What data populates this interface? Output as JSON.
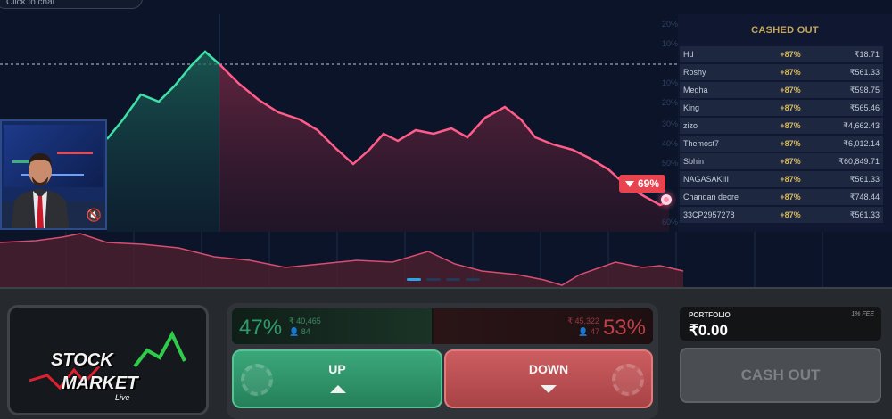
{
  "chat": {
    "placeholder": "Click to chat"
  },
  "chart": {
    "ylabels": [
      "20%",
      "10%",
      "10%",
      "20%",
      "30%",
      "40%",
      "50%",
      "60%"
    ],
    "current_label": "69%",
    "colors": {
      "up": "#3fe0a8",
      "down": "#ff5c8a"
    }
  },
  "leaderboard": {
    "title": "CASHED OUT",
    "rows": [
      {
        "name": "Hd",
        "pct": "+87%",
        "amount": "₹18.71"
      },
      {
        "name": "Roshy",
        "pct": "+87%",
        "amount": "₹561.33"
      },
      {
        "name": "Megha",
        "pct": "+87%",
        "amount": "₹598.75"
      },
      {
        "name": "King",
        "pct": "+87%",
        "amount": "₹565.46"
      },
      {
        "name": "zizo",
        "pct": "+87%",
        "amount": "₹4,662.43"
      },
      {
        "name": "Themost7",
        "pct": "+87%",
        "amount": "₹6,012.14"
      },
      {
        "name": "Sbhin",
        "pct": "+87%",
        "amount": "₹60,849.71"
      },
      {
        "name": "NAGASAKIII",
        "pct": "+87%",
        "amount": "₹561.33"
      },
      {
        "name": "Chandan deore",
        "pct": "+87%",
        "amount": "₹748.44"
      },
      {
        "name": "33CP2957278",
        "pct": "+87%",
        "amount": "₹561.33"
      }
    ]
  },
  "logo": {
    "line1": "STOCK",
    "line2": "MARKET",
    "line3": "Live"
  },
  "sentiment": {
    "up_pct": "47%",
    "up_amount": "₹ 40,465",
    "up_players": "84",
    "down_pct": "53%",
    "down_amount": "₹ 45,322",
    "down_players": "47"
  },
  "buttons": {
    "up": "UP",
    "down": "DOWN",
    "cashout": "CASH OUT"
  },
  "portfolio": {
    "label": "PORTFOLIO",
    "fee": "1% FEE",
    "value": "₹0.00"
  }
}
